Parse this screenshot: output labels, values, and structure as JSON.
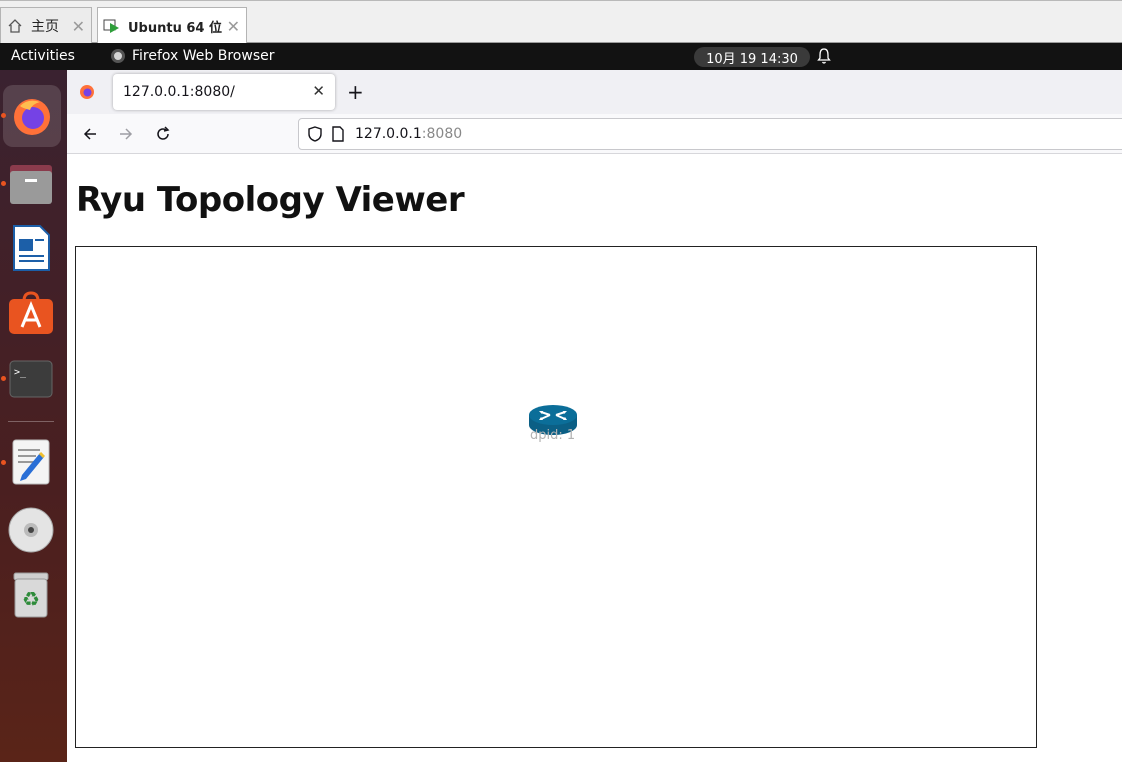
{
  "vmware_tabs": [
    {
      "label": "主页"
    },
    {
      "label": "Ubuntu 64 位"
    }
  ],
  "topbar": {
    "activities": "Activities",
    "app_name": "Firefox Web Browser",
    "clock": "10月 19  14:30"
  },
  "dock": {
    "items": [
      "firefox-icon",
      "files-icon",
      "libreoffice-writer-icon",
      "app-center-icon",
      "terminal-icon",
      "text-editor-icon",
      "dvd-icon",
      "trash-icon"
    ]
  },
  "browser": {
    "tab_title": "127.0.0.1:8080/",
    "url_host": "127.0.0.1",
    "url_port": ":8080"
  },
  "page": {
    "title": "Ryu Topology Viewer",
    "nodes": [
      {
        "label": "dpid: 1"
      }
    ]
  },
  "colors": {
    "switch_icon": "#0b6e99",
    "dock_accent": "#e95420"
  }
}
